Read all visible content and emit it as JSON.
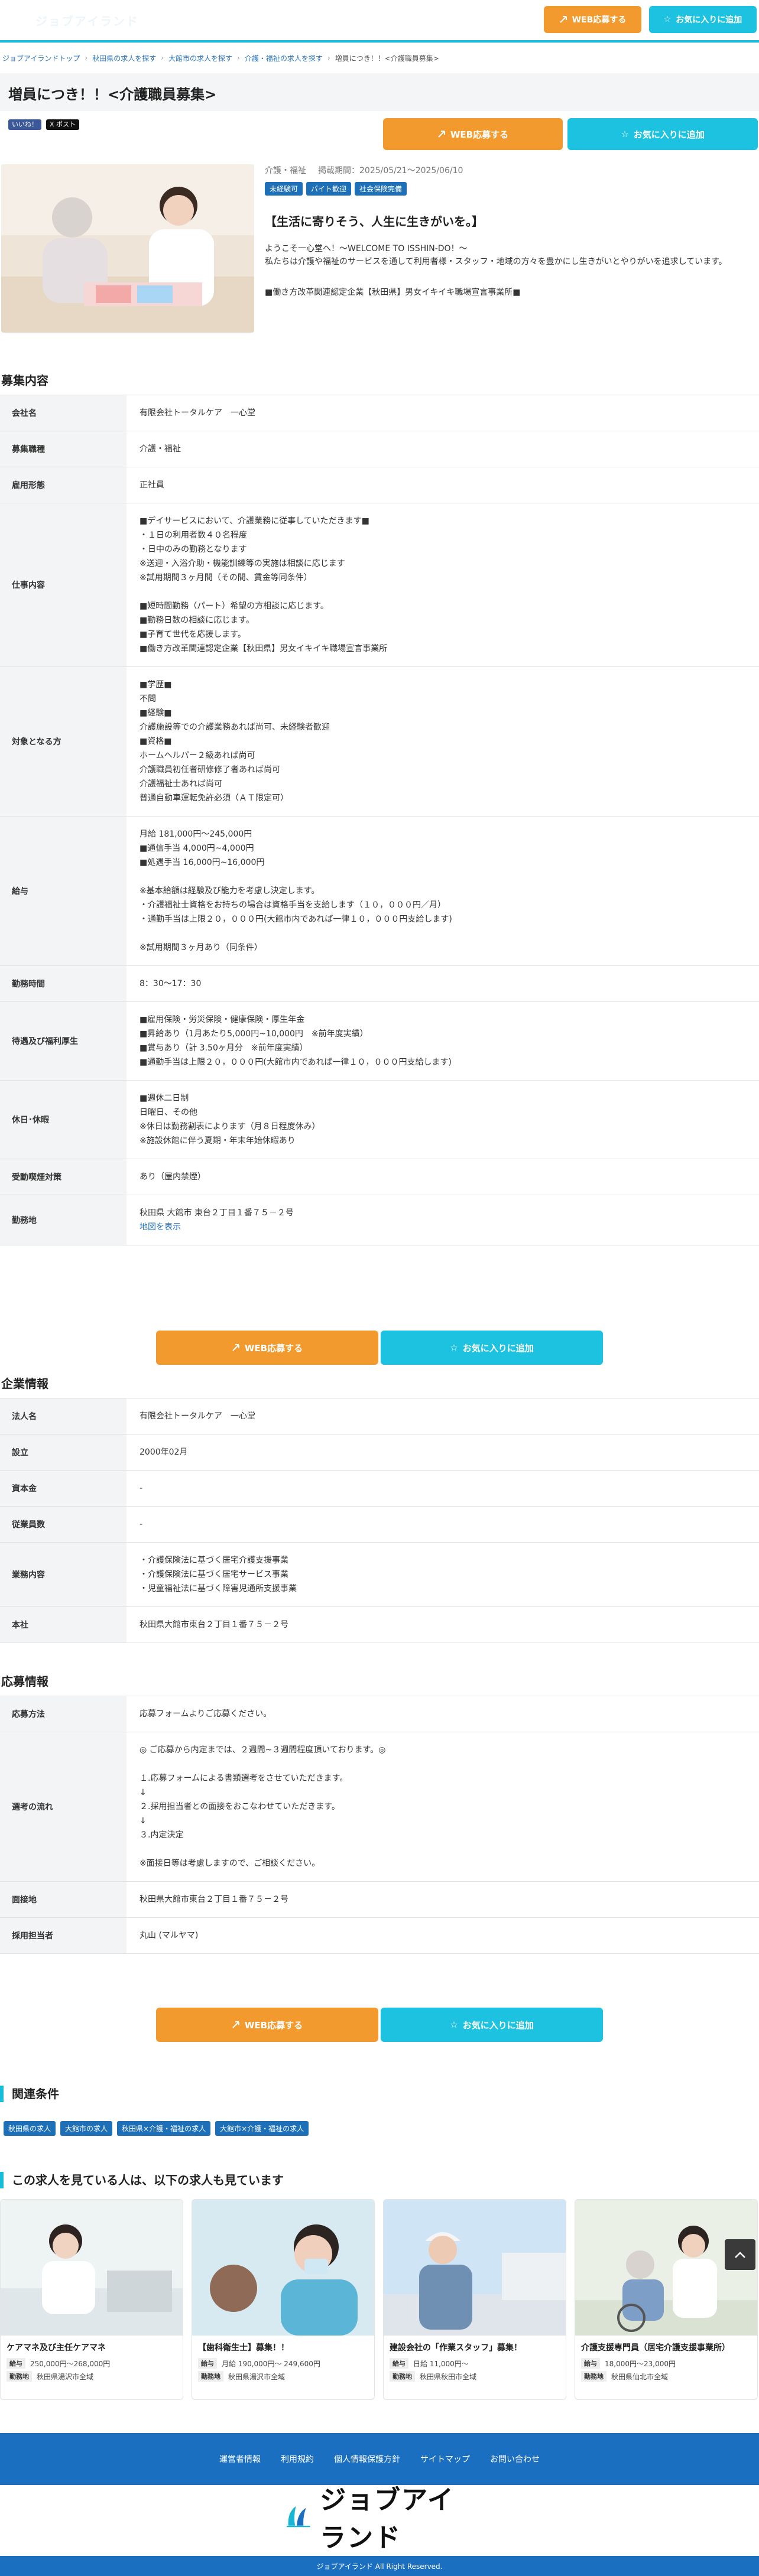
{
  "header": {
    "logo_text": "ジョブアイランド",
    "apply_label": "WEB応募する",
    "favorite_label": "お気に入りに追加"
  },
  "breadcrumb": [
    "ジョブアイランドトップ",
    "秋田県の求人を探す",
    "大館市の求人を探す",
    "介護・福祉の求人を探す",
    "増員につき！！<介護職員募集>"
  ],
  "job": {
    "title": "増員につき！！<介護職員募集>",
    "share_fb": "いいね！",
    "share_x": "X ポスト",
    "apply_label": "WEB応募する",
    "favorite_label": "お気に入りに追加",
    "category": "介護・福祉",
    "period": "掲載期間：2025/05/21〜2025/06/10",
    "tags": [
      "未経験可",
      "パイト歓迎",
      "社会保険完備"
    ],
    "catchcopy": "【生活に寄りそう、人生に生きがいを。】",
    "description": [
      "ようこそ一心堂へ！～WELCOME TO ISSHIN-DO！～",
      "私たちは介護や福祉のサービスを通して利用者様・スタッフ・地域の方々を豊かにし生きがいとやりがいを追求しています。"
    ],
    "certification": "■働き方改革関連認定企業【秋田県】男女イキイキ職場宣言事業所■"
  },
  "recruit": {
    "heading": "募集内容",
    "rows": [
      {
        "label": "会社名",
        "lines": [
          "有限会社トータルケア　一心堂"
        ]
      },
      {
        "label": "募集職種",
        "lines": [
          "介護・福祉"
        ]
      },
      {
        "label": "雇用形態",
        "lines": [
          "正社員"
        ]
      },
      {
        "label": "仕事内容",
        "lines": [
          "■デイサービスにおいて、介護業務に従事していただきます■",
          "・１日の利用者数４０名程度",
          "・日中のみの勤務となります",
          "※送迎・入浴介助・機能訓練等の実施は相談に応じます",
          "※試用期間３ヶ月間（その間、賃金等同条件）",
          "",
          "■短時間勤務（パート）希望の方相談に応じます。",
          "■勤務日数の相談に応じます。",
          "■子育て世代を応援します。",
          "■働き方改革関連認定企業【秋田県】男女イキイキ職場宣言事業所"
        ]
      },
      {
        "label": "対象となる方",
        "lines": [
          "■学歴■",
          "不問",
          "■経験■",
          "介護施設等での介護業務あれば尚可、未経験者歓迎",
          "■資格■",
          "ホームヘルパー２級あれば尚可",
          "介護職員初任者研修修了者あれば尚可",
          "介護福祉士あれば尚可",
          "普通自動車運転免許必須（ＡＴ限定可）"
        ]
      },
      {
        "label": "給与",
        "lines": [
          "月給 181,000円～245,000円",
          "■通信手当 4,000円~4,000円",
          "■処遇手当 16,000円~16,000円",
          "",
          "※基本給額は経験及び能力を考慮し決定します。",
          "・介護福祉士資格をお持ちの場合は資格手当を支給します（１０，０００円／月）",
          "・通勤手当は上限２０，０００円(大館市内であれば一律１０，０００円支給します)",
          "",
          "※試用期間３ヶ月あり（同条件）"
        ]
      },
      {
        "label": "勤務時間",
        "lines": [
          "8：30〜17：30"
        ]
      },
      {
        "label": "待遇及び福利厚生",
        "lines": [
          "■雇用保険・労災保険・健康保険・厚生年金",
          "■昇給あり（1月あたり5,000円~10,000円　※前年度実績）",
          "■賞与あり（計 3.50ヶ月分　※前年度実績）",
          "■通勤手当は上限２０，０００円(大館市内であれば一律１０，０００円支給します)"
        ]
      },
      {
        "label": "休日･休暇",
        "lines": [
          "■週休二日制",
          "日曜日、その他",
          "※休日は勤務割表によります（月８日程度休み）",
          "※施設休館に伴う夏期・年末年始休暇あり"
        ]
      },
      {
        "label": "受動喫煙対策",
        "lines": [
          "あり（屋内禁煙）"
        ]
      },
      {
        "label": "勤務地",
        "lines": [
          "秋田県 大館市 東台２丁目１番７５－２号"
        ],
        "link": "地図を表示"
      }
    ]
  },
  "company": {
    "heading": "企業情報",
    "rows": [
      {
        "label": "法人名",
        "lines": [
          "有限会社トータルケア　一心堂"
        ]
      },
      {
        "label": "設立",
        "lines": [
          "2000年02月"
        ]
      },
      {
        "label": "資本金",
        "lines": [
          "-"
        ]
      },
      {
        "label": "従業員数",
        "lines": [
          "-"
        ]
      },
      {
        "label": "業務内容",
        "lines": [
          "・介護保険法に基づく居宅介護支援事業",
          "・介護保険法に基づく居宅サービス事業",
          "・児童福祉法に基づく障害児通所支援事業"
        ]
      },
      {
        "label": "本社",
        "lines": [
          "秋田県大館市東台２丁目１番７５－２号"
        ]
      }
    ]
  },
  "apply_info": {
    "heading": "応募情報",
    "rows": [
      {
        "label": "応募方法",
        "lines": [
          "応募フォームよりご応募ください。"
        ]
      },
      {
        "label": "選考の流れ",
        "lines": [
          "◎ ご応募から内定までは、２週間~３週間程度頂いております。◎",
          "",
          "１.応募フォームによる書類選考をさせていただきます。",
          "↓",
          "２.採用担当者との面接をおこなわせていただきます。",
          "↓",
          "３.内定決定",
          "",
          "※面接日等は考慮しますので、ご相談ください。"
        ]
      },
      {
        "label": "面接地",
        "lines": [
          "秋田県大館市東台２丁目１番７５－２号"
        ]
      },
      {
        "label": "採用担当者",
        "lines": [
          "丸山 (マルヤマ)"
        ]
      }
    ]
  },
  "related": {
    "heading": "関連条件",
    "tags": [
      "秋田県の求人",
      "大館市の求人",
      "秋田県×介護・福祉の求人",
      "大館市×介護・福祉の求人"
    ]
  },
  "recommend": {
    "heading": "この求人を見ている人は、以下の求人も見ています",
    "cards": [
      {
        "title": "ケアマネ及び主任ケアマネ",
        "salary_key": "給与",
        "salary": "250,000円～268,000円",
        "place_key": "勤務地",
        "place": "秋田県湯沢市全域"
      },
      {
        "title": "【歯科衛生士】募集！！",
        "salary_key": "給与",
        "salary": "月給 190,000円～ 249,600円",
        "place_key": "勤務地",
        "place": "秋田県湯沢市全域"
      },
      {
        "title": "建設会社の「作業スタッフ」募集！",
        "salary_key": "給与",
        "salary": "日給 11,000円～",
        "place_key": "勤務地",
        "place": "秋田県秋田市全域"
      },
      {
        "title": "介護支援専門員（居宅介護支援事業所）",
        "salary_key": "給与",
        "salary": "18,000円～23,000円",
        "place_key": "勤務地",
        "place": "秋田県仙北市全域"
      }
    ]
  },
  "footer": {
    "links": [
      "運営者情報",
      "利用規約",
      "個人情報保護方針",
      "サイトマップ",
      "お問い合わせ"
    ],
    "logo_text": "ジョブアイランド",
    "copyright": "ジョブアイランド All Right Reserved."
  },
  "colors": {
    "accent_cyan": "#17bdd9",
    "button_orange": "#f39a2e",
    "tag_blue": "#1d6fb8",
    "footer_blue": "#1a6fc0"
  }
}
